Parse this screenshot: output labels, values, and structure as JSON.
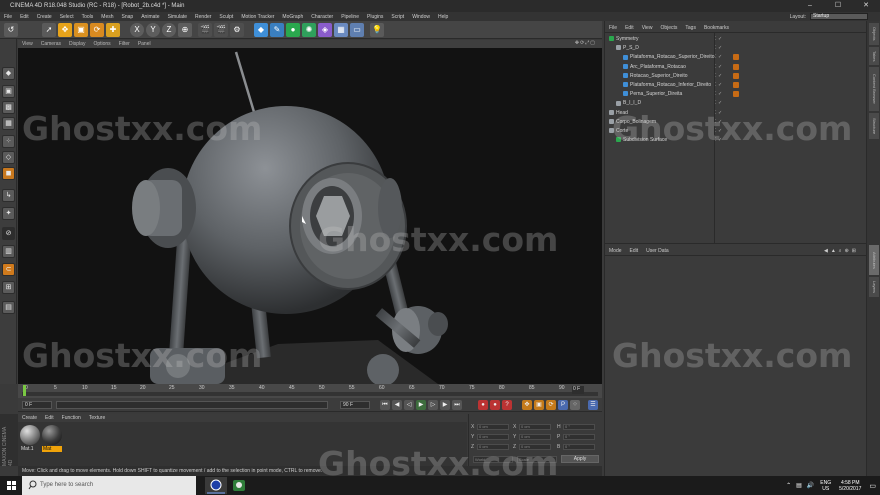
{
  "window": {
    "title": "CINEMA 4D R18.048 Studio (RC - R18) - [Robot_2b.c4d *] - Main",
    "controls": [
      "–",
      "☐",
      "✕"
    ]
  },
  "menu": [
    "File",
    "Edit",
    "Create",
    "Select",
    "Tools",
    "Mesh",
    "Snap",
    "Animate",
    "Simulate",
    "Render",
    "Sculpt",
    "Motion Tracker",
    "MoGraph",
    "Character",
    "Pipeline",
    "Plugins",
    "Script",
    "Window",
    "Help"
  ],
  "layout": {
    "label": "Layout:",
    "value": "Startup"
  },
  "toolbar": {
    "undo": "↺",
    "x": "X",
    "y": "Y",
    "z": "Z"
  },
  "viewport": {
    "menu": [
      "View",
      "Cameras",
      "Display",
      "Options",
      "Filter",
      "Panel"
    ],
    "icons": "✥⟳⤢▢"
  },
  "timeline": {
    "ticks": [
      "0",
      "5",
      "10",
      "15",
      "20",
      "25",
      "30",
      "35",
      "40",
      "45",
      "50",
      "55",
      "60",
      "65",
      "70",
      "75",
      "80",
      "85",
      "90"
    ],
    "current_frame": "0 F"
  },
  "transport": {
    "start": "0 F",
    "end": "90 F"
  },
  "materials": {
    "menu": [
      "Create",
      "Edit",
      "Function",
      "Texture"
    ],
    "items": [
      "Mat.1",
      "Mat"
    ],
    "brand": "MAXON CINEMA 4D"
  },
  "coords": {
    "labels": [
      "X",
      "Y",
      "Z"
    ],
    "rot_labels": [
      "H",
      "P",
      "B"
    ],
    "values": [
      "0 cm",
      "0 cm",
      "0 cm"
    ],
    "rot_values": [
      "0 °",
      "0 °",
      "0 °"
    ],
    "mode1": "World",
    "mode2": "Scale",
    "apply": "Apply"
  },
  "status": "Move: Click and drag to move elements. Hold down SHIFT to quantize movement / add to the selection in point mode, CTRL to remove.",
  "objects": {
    "menu": [
      "File",
      "Edit",
      "View",
      "Objects",
      "Tags",
      "Bookmarks"
    ],
    "items": [
      {
        "name": "Symmetry",
        "indent": 0,
        "tag": false
      },
      {
        "name": "P_S_D",
        "indent": 1,
        "tag": false
      },
      {
        "name": "Plataforma_Rotacao_Superior_Direito",
        "indent": 2,
        "tag": true
      },
      {
        "name": "Arc_Plataforma_Rotacao",
        "indent": 2,
        "tag": true
      },
      {
        "name": "Rotacao_Superior_Direito",
        "indent": 2,
        "tag": true
      },
      {
        "name": "Plataforma_Rotacao_Inferior_Direito",
        "indent": 2,
        "tag": true
      },
      {
        "name": "Perna_Superior_Direita",
        "indent": 2,
        "tag": true
      },
      {
        "name": "B_I_I_D",
        "indent": 1,
        "tag": false
      },
      {
        "name": "Head",
        "indent": 0,
        "tag": false
      },
      {
        "name": "Corpo_Bolinagem",
        "indent": 0,
        "tag": false
      },
      {
        "name": "Corte",
        "indent": 0,
        "tag": false
      },
      {
        "name": "Subdivision Surface",
        "indent": 1,
        "tag": false
      }
    ]
  },
  "attributes": {
    "menu": [
      "Mode",
      "Edit",
      "User Data"
    ],
    "icons": "◀▲⌕⊕⊞"
  },
  "right_tabs": [
    "Objects",
    "Takes",
    "Content Browser",
    "Structure",
    "Attributes",
    "Layers"
  ],
  "taskbar": {
    "search_placeholder": "Type here to search",
    "language": [
      "ENG",
      "US"
    ],
    "time": "4:58 PM",
    "date": "5/20/2017"
  },
  "watermark": "Ghostxx.com",
  "colors": {
    "accent_orange": "#c76b15",
    "highlight_yellow": "#f0a30a",
    "timeline_green": "#7ac943",
    "panel": "#3b3b3b"
  }
}
